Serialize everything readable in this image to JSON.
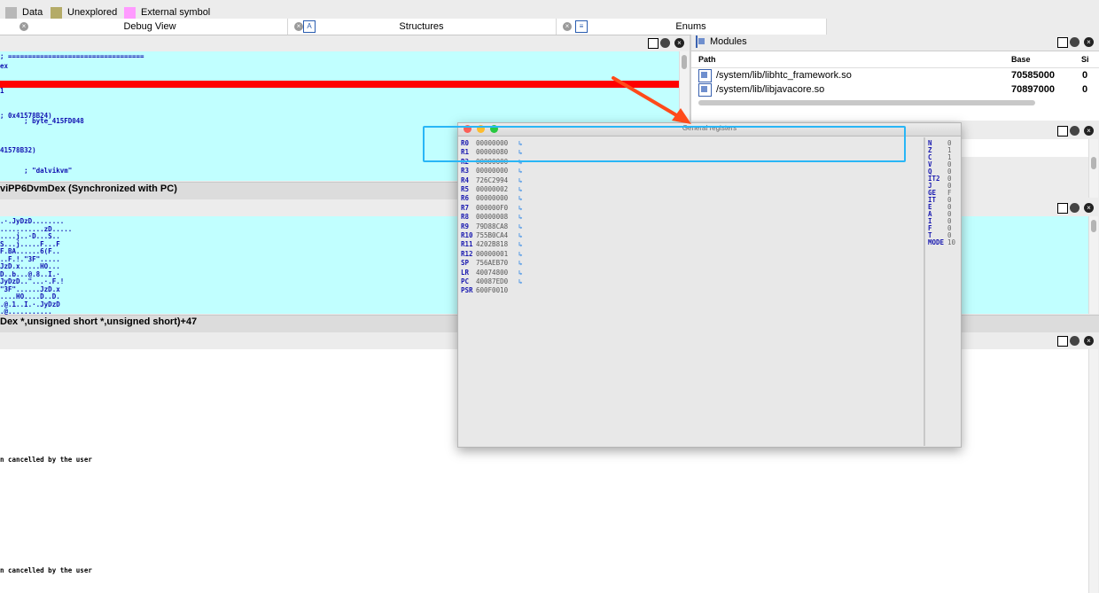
{
  "legend": [
    {
      "label": "Data",
      "color": "#b8b8b8"
    },
    {
      "label": "Unexplored",
      "color": "#b4ab67"
    },
    {
      "label": "External symbol",
      "color": "#ff9bff"
    }
  ],
  "tabs": {
    "debug_view": "Debug View",
    "structures": "Structures",
    "structures_icon": "A",
    "enums": "Enums"
  },
  "disasm": {
    "lines": [
      "; ==================================",
      "",
      "ex",
      "",
      "",
      "",
      "",
      "1",
      "",
      "",
      "",
      "",
      "; 0x41578B24)",
      "      ; byte_415FD048",
      "",
      "",
      "",
      "",
      "",
      "41578B32)",
      "",
      "",
      "",
      "      ; \"dalvikvm\""
    ],
    "status": "viPP6DvmDex  (Synchronized with PC)"
  },
  "hexdump": {
    "lines": [
      ".·.JyDzD........",
      "...........zD.....",
      "....j..·D...S..",
      "S...j.....F...F",
      "F.BA......6(F..",
      "..F.!.\"3F\".....",
      "JzD.x.....HO...",
      "D..b...@.8..I.·",
      "JyDzD..\"...·.F.!",
      "\"3F\"......JzD.x",
      "....HO....D..D.",
      ".@.1..I.·.JyDzD",
      ".@..........."
    ],
    "status": "Dex *,unsigned short *,unsigned short)+47"
  },
  "output": {
    "lines": [
      "n cancelled by the user",
      "n cancelled by the user"
    ]
  },
  "modules": {
    "title": "Modules",
    "columns": [
      "Path",
      "Base",
      "Si"
    ],
    "rows": [
      {
        "path": "/system/lib/libhtc_framework.so",
        "base": "70585000",
        "size": "0"
      },
      {
        "path": "/system/lib/libjavacore.so",
        "base": "70897000",
        "size": "0"
      }
    ]
  },
  "registers_window": {
    "title": "General registers",
    "registers": [
      {
        "name": "R0",
        "value": "00000000"
      },
      {
        "name": "R1",
        "value": "00000080"
      },
      {
        "name": "R2",
        "value": "00000000"
      },
      {
        "name": "R3",
        "value": "00000000"
      },
      {
        "name": "R4",
        "value": "726C2994"
      },
      {
        "name": "R5",
        "value": "00000002"
      },
      {
        "name": "R6",
        "value": "00000000"
      },
      {
        "name": "R7",
        "value": "000000F0"
      },
      {
        "name": "R8",
        "value": "00000008"
      },
      {
        "name": "R9",
        "value": "79D88CA8"
      },
      {
        "name": "R10",
        "value": "755B0CA4"
      },
      {
        "name": "R11",
        "value": "4202B818"
      },
      {
        "name": "R12",
        "value": "00000001"
      },
      {
        "name": "SP",
        "value": "756AEB70"
      },
      {
        "name": "LR",
        "value": "40074800"
      },
      {
        "name": "PC",
        "value": "40087ED0"
      },
      {
        "name": "PSR",
        "value": "600F0010"
      }
    ],
    "flags": [
      {
        "name": "N",
        "value": "0"
      },
      {
        "name": "Z",
        "value": "1"
      },
      {
        "name": "C",
        "value": "1"
      },
      {
        "name": "V",
        "value": "0"
      },
      {
        "name": "Q",
        "value": "0"
      },
      {
        "name": "IT2",
        "value": "0"
      },
      {
        "name": "J",
        "value": "0"
      },
      {
        "name": "GE",
        "value": "F"
      },
      {
        "name": "IT",
        "value": "0"
      },
      {
        "name": "E",
        "value": "0"
      },
      {
        "name": "A",
        "value": "0"
      },
      {
        "name": "I",
        "value": "0"
      },
      {
        "name": "F",
        "value": "0"
      },
      {
        "name": "T",
        "value": "0"
      },
      {
        "name": "MODE",
        "value": "10"
      }
    ]
  },
  "colors": {
    "accent_highlight_box": "#29b6f6",
    "arrow": "#ff4a1a",
    "cyan_pane": "#c1ffff",
    "current_line": "#ff0000"
  }
}
